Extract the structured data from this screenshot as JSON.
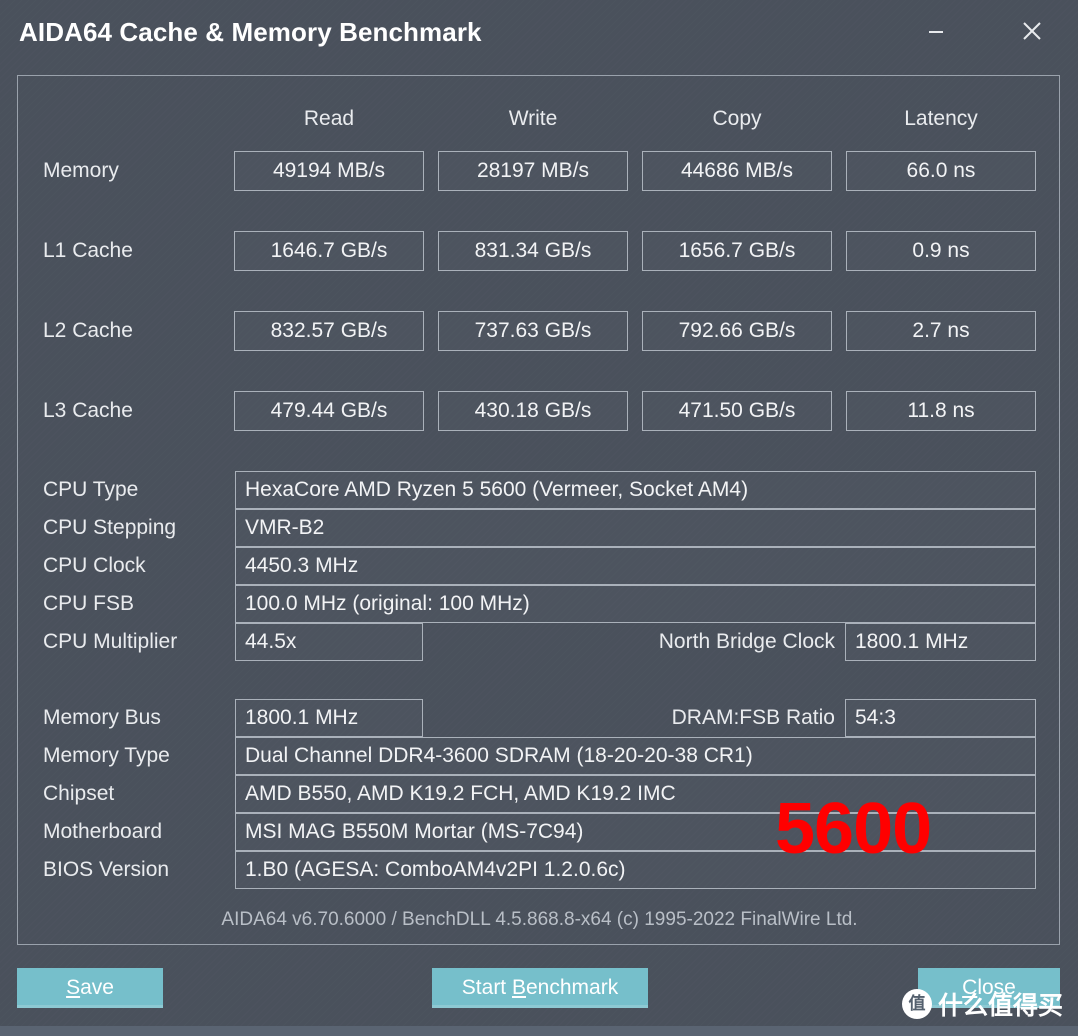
{
  "window": {
    "title": "AIDA64 Cache & Memory Benchmark",
    "minimize_label": "minimize",
    "close_label": "close"
  },
  "benchmark": {
    "columns": [
      "Read",
      "Write",
      "Copy",
      "Latency"
    ],
    "rows": [
      {
        "label": "Memory",
        "values": [
          "49194 MB/s",
          "28197 MB/s",
          "44686 MB/s",
          "66.0 ns"
        ]
      },
      {
        "label": "L1 Cache",
        "values": [
          "1646.7 GB/s",
          "831.34 GB/s",
          "1656.7 GB/s",
          "0.9 ns"
        ]
      },
      {
        "label": "L2 Cache",
        "values": [
          "832.57 GB/s",
          "737.63 GB/s",
          "792.66 GB/s",
          "2.7 ns"
        ]
      },
      {
        "label": "L3 Cache",
        "values": [
          "479.44 GB/s",
          "430.18 GB/s",
          "471.50 GB/s",
          "11.8 ns"
        ]
      }
    ]
  },
  "cpu_info": {
    "type_label": "CPU Type",
    "type_value": "HexaCore AMD Ryzen 5 5600  (Vermeer, Socket AM4)",
    "stepping_label": "CPU Stepping",
    "stepping_value": "VMR-B2",
    "clock_label": "CPU Clock",
    "clock_value": "4450.3 MHz",
    "fsb_label": "CPU FSB",
    "fsb_value": "100.0 MHz  (original: 100 MHz)",
    "multiplier_label": "CPU Multiplier",
    "multiplier_value": "44.5x",
    "north_bridge_label": "North Bridge Clock",
    "north_bridge_value": "1800.1 MHz"
  },
  "memory_info": {
    "bus_label": "Memory Bus",
    "bus_value": "1800.1 MHz",
    "dram_fsb_label": "DRAM:FSB Ratio",
    "dram_fsb_value": "54:3",
    "type_label": "Memory Type",
    "type_value": "Dual Channel DDR4-3600 SDRAM  (18-20-20-38 CR1)",
    "chipset_label": "Chipset",
    "chipset_value": "AMD B550, AMD K19.2 FCH, AMD K19.2 IMC",
    "motherboard_label": "Motherboard",
    "motherboard_value": "MSI MAG B550M Mortar (MS-7C94)",
    "bios_label": "BIOS Version",
    "bios_value": "1.B0  (AGESA: ComboAM4v2PI 1.2.0.6c)"
  },
  "overlay": {
    "text": "5600",
    "color": "#ff0000"
  },
  "footer": {
    "credits": "AIDA64 v6.70.6000 / BenchDLL 4.5.868.8-x64  (c) 1995-2022 FinalWire Ltd."
  },
  "buttons": {
    "save": {
      "prefix": "",
      "accel": "S",
      "suffix": "ave"
    },
    "start": {
      "prefix": "Start ",
      "accel": "B",
      "suffix": "enchmark"
    },
    "close": {
      "prefix": "",
      "accel": "C",
      "suffix": "lose"
    },
    "accent_color": "#76bfcb"
  },
  "watermark": {
    "logo_char": "值",
    "text": "什么值得买"
  }
}
